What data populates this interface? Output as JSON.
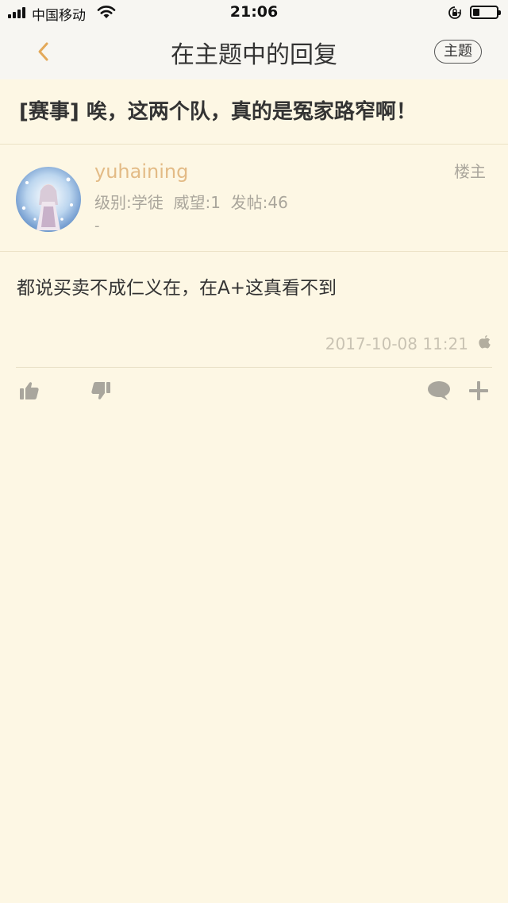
{
  "status_bar": {
    "carrier": "中国移动",
    "time": "21:06"
  },
  "nav": {
    "title": "在主题中的回复",
    "topic_button": "主题"
  },
  "thread": {
    "title": "[赛事] 唉，这两个队，真的是冤家路窄啊！"
  },
  "author": {
    "name": "yuhaining",
    "meta": "级别:学徒  威望:1  发帖:46",
    "signature": "-",
    "floor_label": "楼主"
  },
  "post": {
    "content": "都说买卖不成仁义在，在A+这真看不到",
    "time": "2017-10-08 11:21"
  },
  "colors": {
    "background": "#fdf7e4",
    "accent": "#e3bb86",
    "muted": "#aaa69c"
  },
  "icons": {
    "back": "chevron-left-icon",
    "platform": "apple-icon",
    "like": "thumbs-up-icon",
    "dislike": "thumbs-down-icon",
    "comment": "comment-icon",
    "more": "plus-icon"
  }
}
